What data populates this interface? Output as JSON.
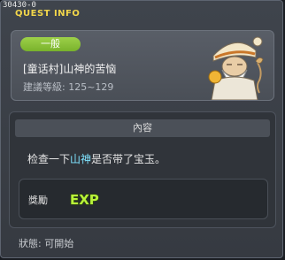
{
  "window": {
    "quest_id": "30430-0",
    "title": "QUEST INFO"
  },
  "quest": {
    "category": "一般",
    "name": "[童话村]山神的苦恼",
    "level_req": "建議等級: 125~129"
  },
  "content": {
    "header": "內容",
    "desc_before": "检查一下",
    "desc_highlight": "山神",
    "desc_after": "是否带了宝玉。"
  },
  "reward": {
    "label": "獎勵",
    "icon": "exp-icon",
    "icon_text": "EXP"
  },
  "status": {
    "text": "狀態: 可開始"
  },
  "colors": {
    "title": "#f2d64a",
    "badge": "#8cc53c",
    "highlight": "#7fe4ff",
    "exp": "#b8f23a"
  }
}
